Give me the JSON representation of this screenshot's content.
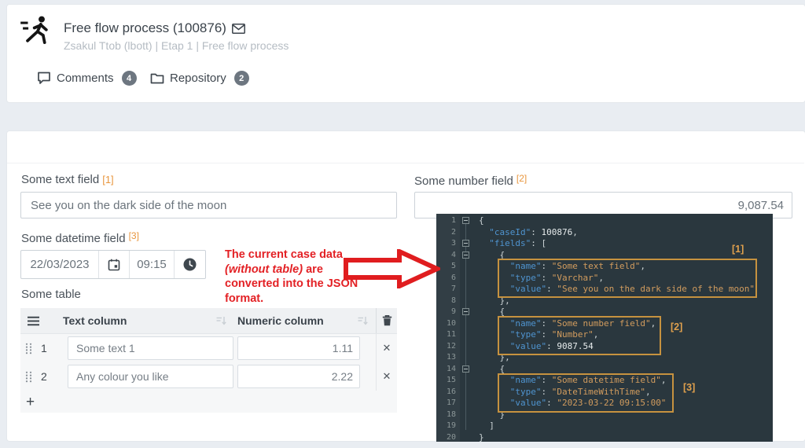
{
  "header": {
    "title": "Free flow process (100876)",
    "subtitle": "Zsakul Ttob (lbott) | Etap 1 | Free flow process",
    "tabs": [
      {
        "label": "Comments",
        "count": "4"
      },
      {
        "label": "Repository",
        "count": "2"
      }
    ]
  },
  "form": {
    "text_field": {
      "label": "Some text field",
      "ref": "[1]",
      "value": "See you on the dark side of the moon"
    },
    "number_field": {
      "label": "Some number field",
      "ref": "[2]",
      "value": "9,087.54"
    },
    "datetime_field": {
      "label": "Some datetime field",
      "ref": "[3]",
      "date": "22/03/2023",
      "time": "09:15"
    },
    "table": {
      "label": "Some table",
      "columns": [
        {
          "label": "Text column"
        },
        {
          "label": "Numeric column"
        }
      ],
      "rows": [
        {
          "index": "1",
          "text": "Some text 1",
          "number": "1.11"
        },
        {
          "index": "2",
          "text": "Any colour you like",
          "number": "2.22"
        }
      ],
      "add_button": "+",
      "delete_button": "✕"
    }
  },
  "annotation": {
    "color": "#e32125",
    "lines": [
      [
        {
          "t": "The current case data"
        }
      ],
      [
        {
          "t": "(without table)",
          "i": true
        },
        {
          "t": " are"
        }
      ],
      [
        {
          "t": "converted into the JSON"
        }
      ],
      [
        {
          "t": "format."
        }
      ]
    ]
  },
  "code_panel": {
    "background": "#2a373e",
    "colors": {
      "key": "#4f94d0",
      "string": "#d29c5e",
      "number": "#e6ebec",
      "punct": "#ccd4d6",
      "line_number": "#8b9697",
      "box": "#c6923f",
      "ref": "#e0a04d"
    },
    "refs": [
      "[1]",
      "[2]",
      "[3]"
    ],
    "lines": [
      {
        "n": "1",
        "fold": true,
        "indent": 0,
        "tokens": [
          [
            "p",
            "{"
          ]
        ]
      },
      {
        "n": "2",
        "fold": false,
        "indent": 2,
        "tokens": [
          [
            "k",
            "\"caseId\""
          ],
          [
            "p",
            ": "
          ],
          [
            "num",
            "100876"
          ],
          [
            "p",
            ","
          ]
        ]
      },
      {
        "n": "3",
        "fold": true,
        "indent": 2,
        "tokens": [
          [
            "k",
            "\"fields\""
          ],
          [
            "p",
            ": ["
          ]
        ]
      },
      {
        "n": "4",
        "fold": true,
        "indent": 4,
        "tokens": [
          [
            "p",
            "{"
          ]
        ]
      },
      {
        "n": "5",
        "fold": false,
        "indent": 6,
        "tokens": [
          [
            "k",
            "\"name\""
          ],
          [
            "p",
            ": "
          ],
          [
            "s",
            "\"Some text field\""
          ],
          [
            "p",
            ","
          ]
        ]
      },
      {
        "n": "6",
        "fold": false,
        "indent": 6,
        "tokens": [
          [
            "k",
            "\"type\""
          ],
          [
            "p",
            ": "
          ],
          [
            "s",
            "\"Varchar\""
          ],
          [
            "p",
            ","
          ]
        ]
      },
      {
        "n": "7",
        "fold": false,
        "indent": 6,
        "tokens": [
          [
            "k",
            "\"value\""
          ],
          [
            "p",
            ": "
          ],
          [
            "s",
            "\"See you on the dark side of the moon\""
          ]
        ]
      },
      {
        "n": "8",
        "fold": false,
        "indent": 4,
        "tokens": [
          [
            "p",
            "},"
          ]
        ]
      },
      {
        "n": "9",
        "fold": true,
        "indent": 4,
        "tokens": [
          [
            "p",
            "{"
          ]
        ]
      },
      {
        "n": "10",
        "fold": false,
        "indent": 6,
        "tokens": [
          [
            "k",
            "\"name\""
          ],
          [
            "p",
            ": "
          ],
          [
            "s",
            "\"Some number field\""
          ],
          [
            "p",
            ","
          ]
        ]
      },
      {
        "n": "11",
        "fold": false,
        "indent": 6,
        "tokens": [
          [
            "k",
            "\"type\""
          ],
          [
            "p",
            ": "
          ],
          [
            "s",
            "\"Number\""
          ],
          [
            "p",
            ","
          ]
        ]
      },
      {
        "n": "12",
        "fold": false,
        "indent": 6,
        "tokens": [
          [
            "k",
            "\"value\""
          ],
          [
            "p",
            ": "
          ],
          [
            "num",
            "9087.54"
          ]
        ]
      },
      {
        "n": "13",
        "fold": false,
        "indent": 4,
        "tokens": [
          [
            "p",
            "},"
          ]
        ]
      },
      {
        "n": "14",
        "fold": true,
        "indent": 4,
        "tokens": [
          [
            "p",
            "{"
          ]
        ]
      },
      {
        "n": "15",
        "fold": false,
        "indent": 6,
        "tokens": [
          [
            "k",
            "\"name\""
          ],
          [
            "p",
            ": "
          ],
          [
            "s",
            "\"Some datetime field\""
          ],
          [
            "p",
            ","
          ]
        ]
      },
      {
        "n": "16",
        "fold": false,
        "indent": 6,
        "tokens": [
          [
            "k",
            "\"type\""
          ],
          [
            "p",
            ": "
          ],
          [
            "s",
            "\"DateTimeWithTime\""
          ],
          [
            "p",
            ","
          ]
        ]
      },
      {
        "n": "17",
        "fold": false,
        "indent": 6,
        "tokens": [
          [
            "k",
            "\"value\""
          ],
          [
            "p",
            ": "
          ],
          [
            "s",
            "\"2023-03-22 09:15:00\""
          ]
        ]
      },
      {
        "n": "18",
        "fold": false,
        "indent": 4,
        "tokens": [
          [
            "p",
            "}"
          ]
        ]
      },
      {
        "n": "19",
        "fold": false,
        "indent": 2,
        "tokens": [
          [
            "p",
            "]"
          ]
        ]
      },
      {
        "n": "20",
        "fold": false,
        "indent": 0,
        "tokens": [
          [
            "p",
            "}"
          ]
        ]
      }
    ]
  }
}
